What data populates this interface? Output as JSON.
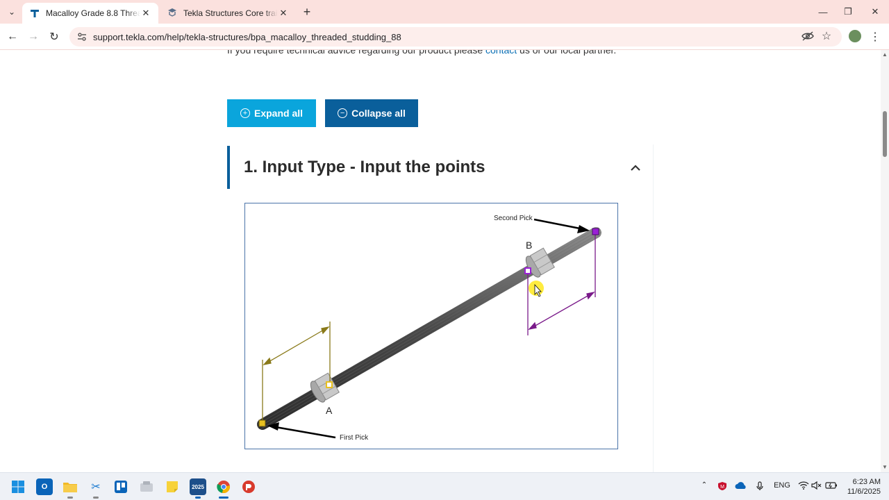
{
  "browser": {
    "tabs": [
      {
        "title": "Macalloy Grade 8.8 Threaded St",
        "active": true
      },
      {
        "title": "Tekla Structures Core training -",
        "active": false
      }
    ],
    "url": "support.tekla.com/help/tekla-structures/bpa_macalloy_threaded_studding_88"
  },
  "page": {
    "intro_before": "If you require technical advice regarding our product please ",
    "intro_link": "contact",
    "intro_after": " us or our local partner.",
    "expand_label": "Expand all",
    "collapse_label": "Collapse all",
    "section_title": "1. Input Type - Input the points",
    "figure": {
      "second_pick": "Second Pick",
      "first_pick": "First Pick",
      "label_a": "A",
      "label_b": "B"
    }
  },
  "taskbar": {
    "lang": "ENG",
    "time": "6:23 AM",
    "date": "11/6/2025"
  },
  "colors": {
    "expand_button": "#0aa5dc",
    "collapse_button": "#0a5f9b",
    "section_accent": "#0a5f9b",
    "tabbar": "#fbe1de",
    "first_pick_marker": "#e8c020",
    "second_pick_marker": "#9b1fd6",
    "dimension_a": "#8a7a1a",
    "dimension_b": "#7a1a8a"
  }
}
